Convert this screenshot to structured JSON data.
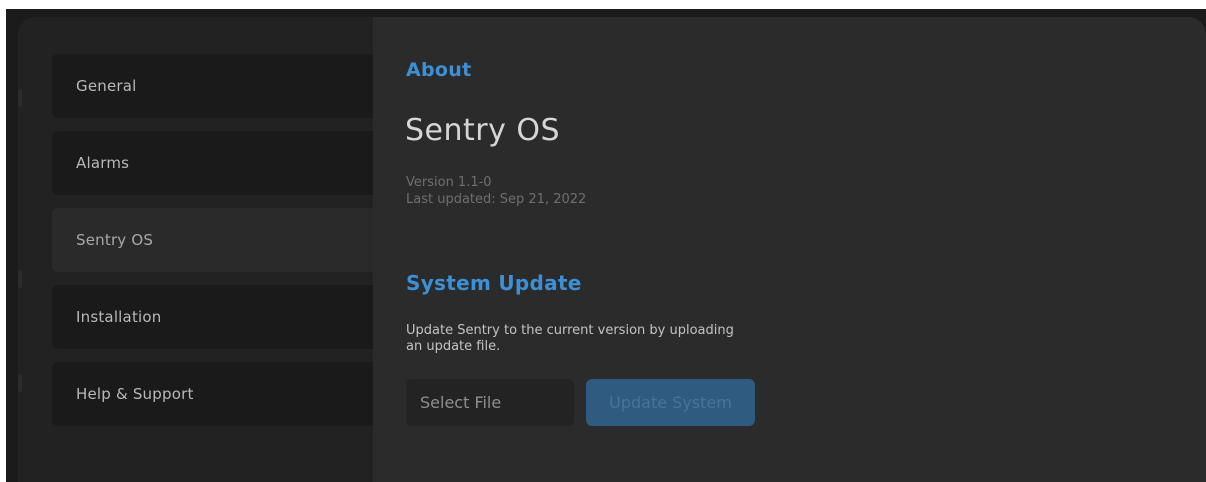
{
  "sidebar": {
    "items": [
      {
        "label": "General",
        "active": false
      },
      {
        "label": "Alarms",
        "active": false
      },
      {
        "label": "Sentry OS",
        "active": true
      },
      {
        "label": "Installation",
        "active": false
      },
      {
        "label": "Help & Support",
        "active": false
      }
    ]
  },
  "about": {
    "heading": "About",
    "product_name": "Sentry OS",
    "version": "Version 1.1-0",
    "last_updated": "Last updated: Sep 21, 2022"
  },
  "system_update": {
    "heading": "System Update",
    "description": "Update Sentry to the current version by uploading an update file.",
    "select_file_label": "Select File",
    "update_button_label": "Update System",
    "update_button_enabled": false
  },
  "colors": {
    "accent": "#3d8fd6",
    "background": "#1b1b1c",
    "panel": "#2b2b2c",
    "nav_item": "#1a1a1b",
    "nav_item_active": "#2a2a2b",
    "update_button": "#2f5b80"
  }
}
